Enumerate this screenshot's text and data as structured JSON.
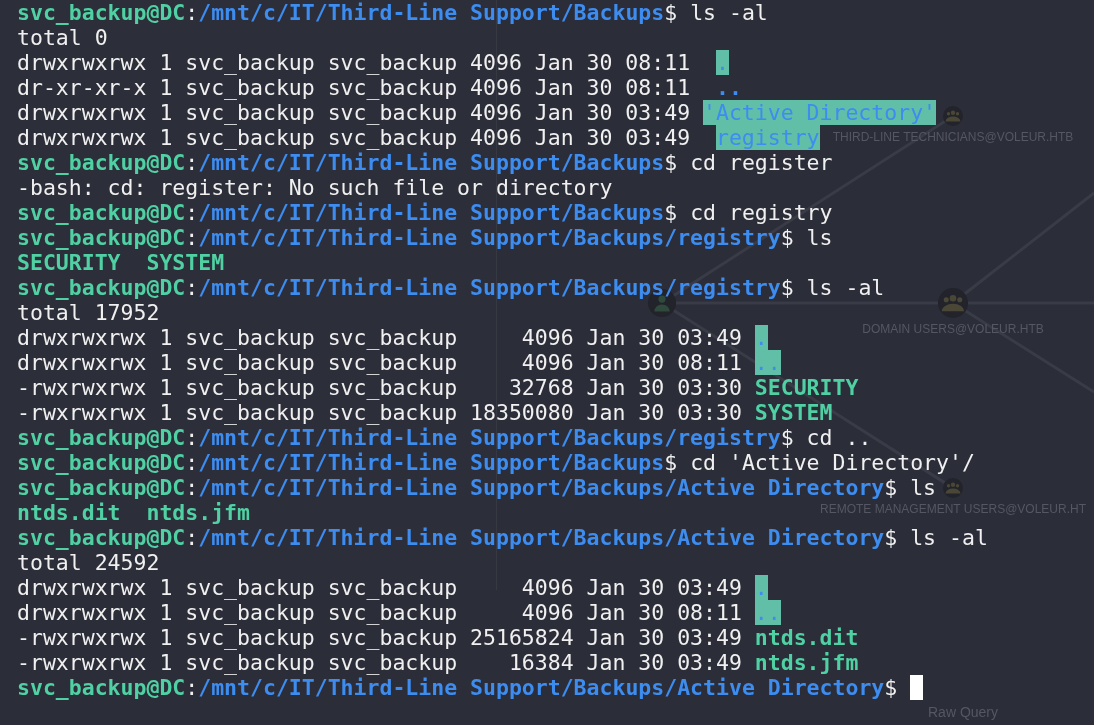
{
  "terminal": {
    "lines": [
      {
        "kind": "prompt",
        "user": "svc_backup@DC",
        "separator": ":",
        "path": "/mnt/c/IT/Third-Line Support/Backups",
        "symbol": "$",
        "command": "ls -al",
        "cursor": false
      },
      {
        "kind": "output",
        "text": "total 0"
      },
      {
        "kind": "entry",
        "details": "drwxrwxrwx 1 svc_backup svc_backup 4096 Jan 30 08:11",
        "file": {
          "name": ".",
          "kind": "writable_dir"
        }
      },
      {
        "kind": "entry",
        "details": "dr-xr-xr-x 1 svc_backup svc_backup 4096 Jan 30 08:11",
        "file": {
          "name": "..",
          "kind": "dir"
        }
      },
      {
        "kind": "entry",
        "details": "drwxrwxrwx 1 svc_backup svc_backup 4096 Jan 30 03:49",
        "file": {
          "name": "'Active Directory'",
          "kind": "writable_dir"
        }
      },
      {
        "kind": "entry",
        "details": "drwxrwxrwx 1 svc_backup svc_backup 4096 Jan 30 03:49",
        "file": {
          "name": "registry",
          "kind": "writable_dir"
        }
      },
      {
        "kind": "prompt",
        "user": "svc_backup@DC",
        "separator": ":",
        "path": "/mnt/c/IT/Third-Line Support/Backups",
        "symbol": "$",
        "command": "cd register",
        "cursor": false
      },
      {
        "kind": "error",
        "text": "-bash: cd: register: No such file or directory"
      },
      {
        "kind": "prompt",
        "user": "svc_backup@DC",
        "separator": ":",
        "path": "/mnt/c/IT/Third-Line Support/Backups",
        "symbol": "$",
        "command": "cd registry",
        "cursor": false
      },
      {
        "kind": "prompt",
        "user": "svc_backup@DC",
        "separator": ":",
        "path": "/mnt/c/IT/Third-Line Support/Backups/registry",
        "symbol": "$",
        "command": "ls",
        "cursor": false
      },
      {
        "kind": "names",
        "files": [
          {
            "name": "SECURITY",
            "kind": "executable"
          },
          {
            "name": "SYSTEM",
            "kind": "executable"
          }
        ]
      },
      {
        "kind": "prompt",
        "user": "svc_backup@DC",
        "separator": ":",
        "path": "/mnt/c/IT/Third-Line Support/Backups/registry",
        "symbol": "$",
        "command": "ls -al",
        "cursor": false
      },
      {
        "kind": "output",
        "text": "total 17952"
      },
      {
        "kind": "entry",
        "details": "drwxrwxrwx 1 svc_backup svc_backup     4096 Jan 30 03:49",
        "file": {
          "name": ".",
          "kind": "writable_dir"
        }
      },
      {
        "kind": "entry",
        "details": "drwxrwxrwx 1 svc_backup svc_backup     4096 Jan 30 08:11",
        "file": {
          "name": "..",
          "kind": "writable_dir"
        }
      },
      {
        "kind": "entry",
        "details": "-rwxrwxrwx 1 svc_backup svc_backup    32768 Jan 30 03:30",
        "file": {
          "name": "SECURITY",
          "kind": "executable"
        }
      },
      {
        "kind": "entry",
        "details": "-rwxrwxrwx 1 svc_backup svc_backup 18350080 Jan 30 03:30",
        "file": {
          "name": "SYSTEM",
          "kind": "executable"
        }
      },
      {
        "kind": "prompt",
        "user": "svc_backup@DC",
        "separator": ":",
        "path": "/mnt/c/IT/Third-Line Support/Backups/registry",
        "symbol": "$",
        "command": "cd ..",
        "cursor": false
      },
      {
        "kind": "prompt",
        "user": "svc_backup@DC",
        "separator": ":",
        "path": "/mnt/c/IT/Third-Line Support/Backups",
        "symbol": "$",
        "command": "cd 'Active Directory'/",
        "cursor": false
      },
      {
        "kind": "prompt",
        "user": "svc_backup@DC",
        "separator": ":",
        "path": "/mnt/c/IT/Third-Line Support/Backups/Active Directory",
        "symbol": "$",
        "command": "ls",
        "cursor": false
      },
      {
        "kind": "names",
        "files": [
          {
            "name": "ntds.dit",
            "kind": "executable"
          },
          {
            "name": "ntds.jfm",
            "kind": "executable"
          }
        ]
      },
      {
        "kind": "prompt",
        "user": "svc_backup@DC",
        "separator": ":",
        "path": "/mnt/c/IT/Third-Line Support/Backups/Active Directory",
        "symbol": "$",
        "command": "ls -al",
        "cursor": false
      },
      {
        "kind": "output",
        "text": "total 24592"
      },
      {
        "kind": "entry",
        "details": "drwxrwxrwx 1 svc_backup svc_backup     4096 Jan 30 03:49",
        "file": {
          "name": ".",
          "kind": "writable_dir"
        }
      },
      {
        "kind": "entry",
        "details": "drwxrwxrwx 1 svc_backup svc_backup     4096 Jan 30 08:11",
        "file": {
          "name": "..",
          "kind": "writable_dir"
        }
      },
      {
        "kind": "entry",
        "details": "-rwxrwxrwx 1 svc_backup svc_backup 25165824 Jan 30 03:49",
        "file": {
          "name": "ntds.dit",
          "kind": "executable"
        }
      },
      {
        "kind": "entry",
        "details": "-rwxrwxrwx 1 svc_backup svc_backup    16384 Jan 30 03:49",
        "file": {
          "name": "ntds.jfm",
          "kind": "executable"
        }
      },
      {
        "kind": "prompt",
        "user": "svc_backup@DC",
        "separator": ":",
        "path": "/mnt/c/IT/Third-Line Support/Backups/Active Directory",
        "symbol": "$",
        "cursor": true
      }
    ]
  },
  "graph": {
    "nodes": [
      {
        "kind": "group",
        "label": "THIRD-LINE TECHNICIANS@VOLEUR.HTB"
      },
      {
        "kind": "group",
        "label": "DOMAIN USERS@VOLEUR.HTB"
      },
      {
        "kind": "user"
      },
      {
        "kind": "group",
        "label": "REMOTE MANAGEMENT USERS@VOLEUR.HT"
      }
    ],
    "query_tab": {
      "label": "Raw Query"
    }
  }
}
